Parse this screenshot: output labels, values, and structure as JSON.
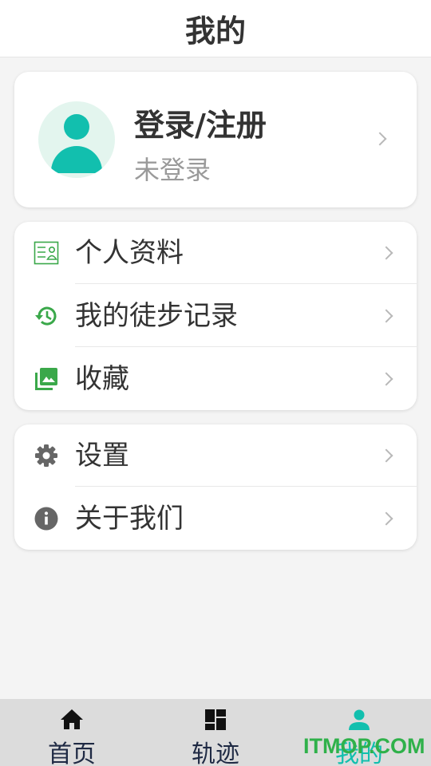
{
  "header": {
    "title": "我的"
  },
  "profile": {
    "name": "登录/注册",
    "status": "未登录",
    "avatar_icon": "person-icon"
  },
  "menu_group_1": [
    {
      "label": "个人资料",
      "icon": "profile-card-icon"
    },
    {
      "label": "我的徒步记录",
      "icon": "history-icon"
    },
    {
      "label": "收藏",
      "icon": "gallery-icon"
    }
  ],
  "menu_group_2": [
    {
      "label": "设置",
      "icon": "gear-icon"
    },
    {
      "label": "关于我们",
      "icon": "info-icon"
    }
  ],
  "tabs": [
    {
      "label": "首页",
      "icon": "home-icon"
    },
    {
      "label": "轨迹",
      "icon": "dashboard-icon"
    },
    {
      "label": "我的",
      "icon": "person-icon",
      "active": true
    }
  ],
  "watermark": "ITMOP.COM",
  "colors": {
    "accent": "#12bfae",
    "icon_green": "#3aa84a",
    "icon_gray": "#666666",
    "watermark": "#2fb14a"
  }
}
